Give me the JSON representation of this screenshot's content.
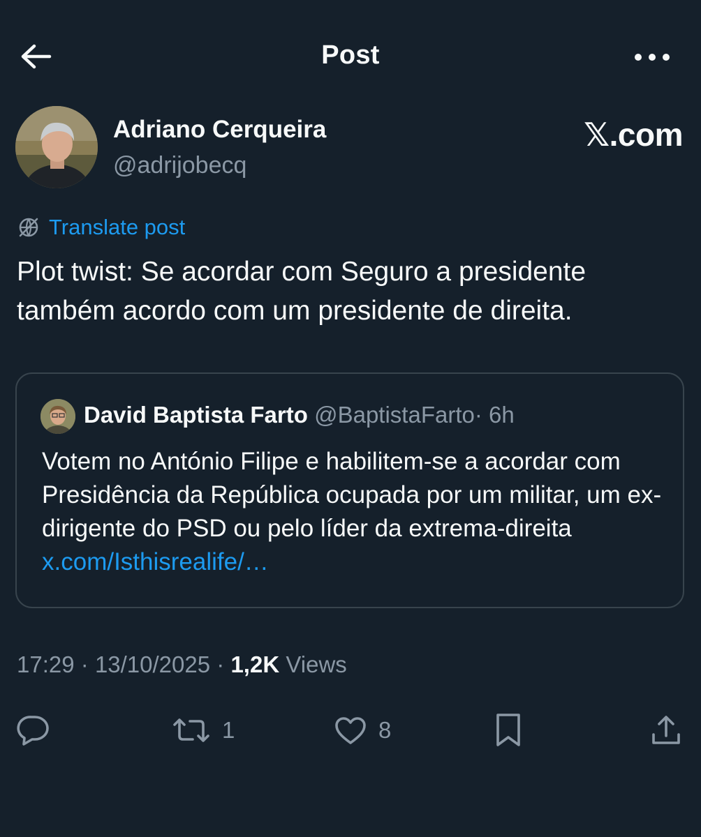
{
  "header": {
    "title": "Post",
    "back_icon": "arrow-left-icon",
    "more_icon": "ellipsis-icon"
  },
  "author": {
    "name": "Adriano Cerqueira",
    "handle": "@adrijobecq"
  },
  "watermark": "𝕏.com",
  "translate": {
    "label": "Translate post",
    "icon": "globe-icon"
  },
  "post": {
    "text": "Plot twist: Se acordar com Seguro a presidente também acordo com um presidente de direita."
  },
  "quote": {
    "name": "David Baptista Farto",
    "handle": "@BaptistaFarto",
    "separator": "·",
    "time": "6h",
    "text": "Votem no António Filipe e habilitem-se  a acordar com Presidência da República ocupada por um militar, um ex-dirigente do PSD ou pelo líder da extrema-direita",
    "link": "x.com/Isthisrealife/…"
  },
  "meta": {
    "time": "17:29",
    "separator": "·",
    "date": "13/10/2025",
    "views_count": "1,2K",
    "views_label": "Views"
  },
  "actions": {
    "reply_count": "",
    "repost_count": "1",
    "like_count": "8"
  },
  "colors": {
    "background": "#15202b",
    "text": "#f7f9f9",
    "secondary": "#8b98a5",
    "accent": "#1d9bf0",
    "border": "#38444d"
  }
}
